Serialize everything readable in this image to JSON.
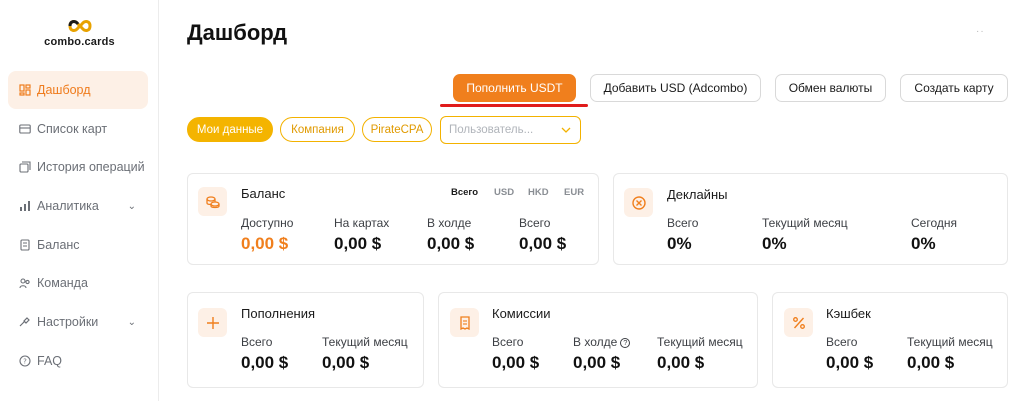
{
  "brand": {
    "name": "combo.cards"
  },
  "sidebar": {
    "items": [
      {
        "label": "Дашборд",
        "icon": "dashboard-icon",
        "active": true
      },
      {
        "label": "Список карт",
        "icon": "card-icon"
      },
      {
        "label": "История операций",
        "icon": "history-icon"
      },
      {
        "label": "Аналитика",
        "icon": "analytics-icon",
        "has_submenu": true
      },
      {
        "label": "Баланс",
        "icon": "wallet-icon"
      },
      {
        "label": "Команда",
        "icon": "team-icon"
      },
      {
        "label": "Настройки",
        "icon": "settings-icon",
        "has_submenu": true
      },
      {
        "label": "FAQ",
        "icon": "help-icon"
      }
    ]
  },
  "header": {
    "title": "Дашборд",
    "more": "··"
  },
  "actions": {
    "topup_usdt": "Пополнить USDT",
    "add_usd": "Добавить USD (Adcombo)",
    "exchange": "Обмен валюты",
    "create_card": "Создать карту"
  },
  "filters": {
    "my_data": "Мои данные",
    "company": "Компания",
    "piratecpa": "PirateCPA",
    "user_placeholder": "Пользователь..."
  },
  "balance": {
    "title": "Баланс",
    "currency_tabs": [
      "Всего",
      "USD",
      "HKD",
      "EUR"
    ],
    "available_label": "Доступно",
    "available_value": "0,00 $",
    "on_cards_label": "На картах",
    "on_cards_value": "0,00 $",
    "on_hold_label": "В холде",
    "on_hold_value": "0,00 $",
    "total_label": "Всего",
    "total_value": "0,00 $"
  },
  "declines": {
    "title": "Деклайны",
    "total_label": "Всего",
    "total_value": "0%",
    "month_label": "Текущий месяц",
    "month_value": "0%",
    "today_label": "Сегодня",
    "today_value": "0%"
  },
  "topups": {
    "title": "Пополнения",
    "total_label": "Всего",
    "total_value": "0,00 $",
    "month_label": "Текущий месяц",
    "month_value": "0,00 $"
  },
  "fees": {
    "title": "Комиссии",
    "total_label": "Всего",
    "total_value": "0,00 $",
    "hold_label": "В холде",
    "hold_value": "0,00 $",
    "month_label": "Текущий месяц",
    "month_value": "0,00 $"
  },
  "cashback": {
    "title": "Кэшбек",
    "total_label": "Всего",
    "total_value": "0,00 $",
    "month_label": "Текущий месяц",
    "month_value": "0,00 $"
  },
  "colors": {
    "accent": "#f07f1d",
    "pill": "#f4b400",
    "underline": "#e01b1b"
  }
}
